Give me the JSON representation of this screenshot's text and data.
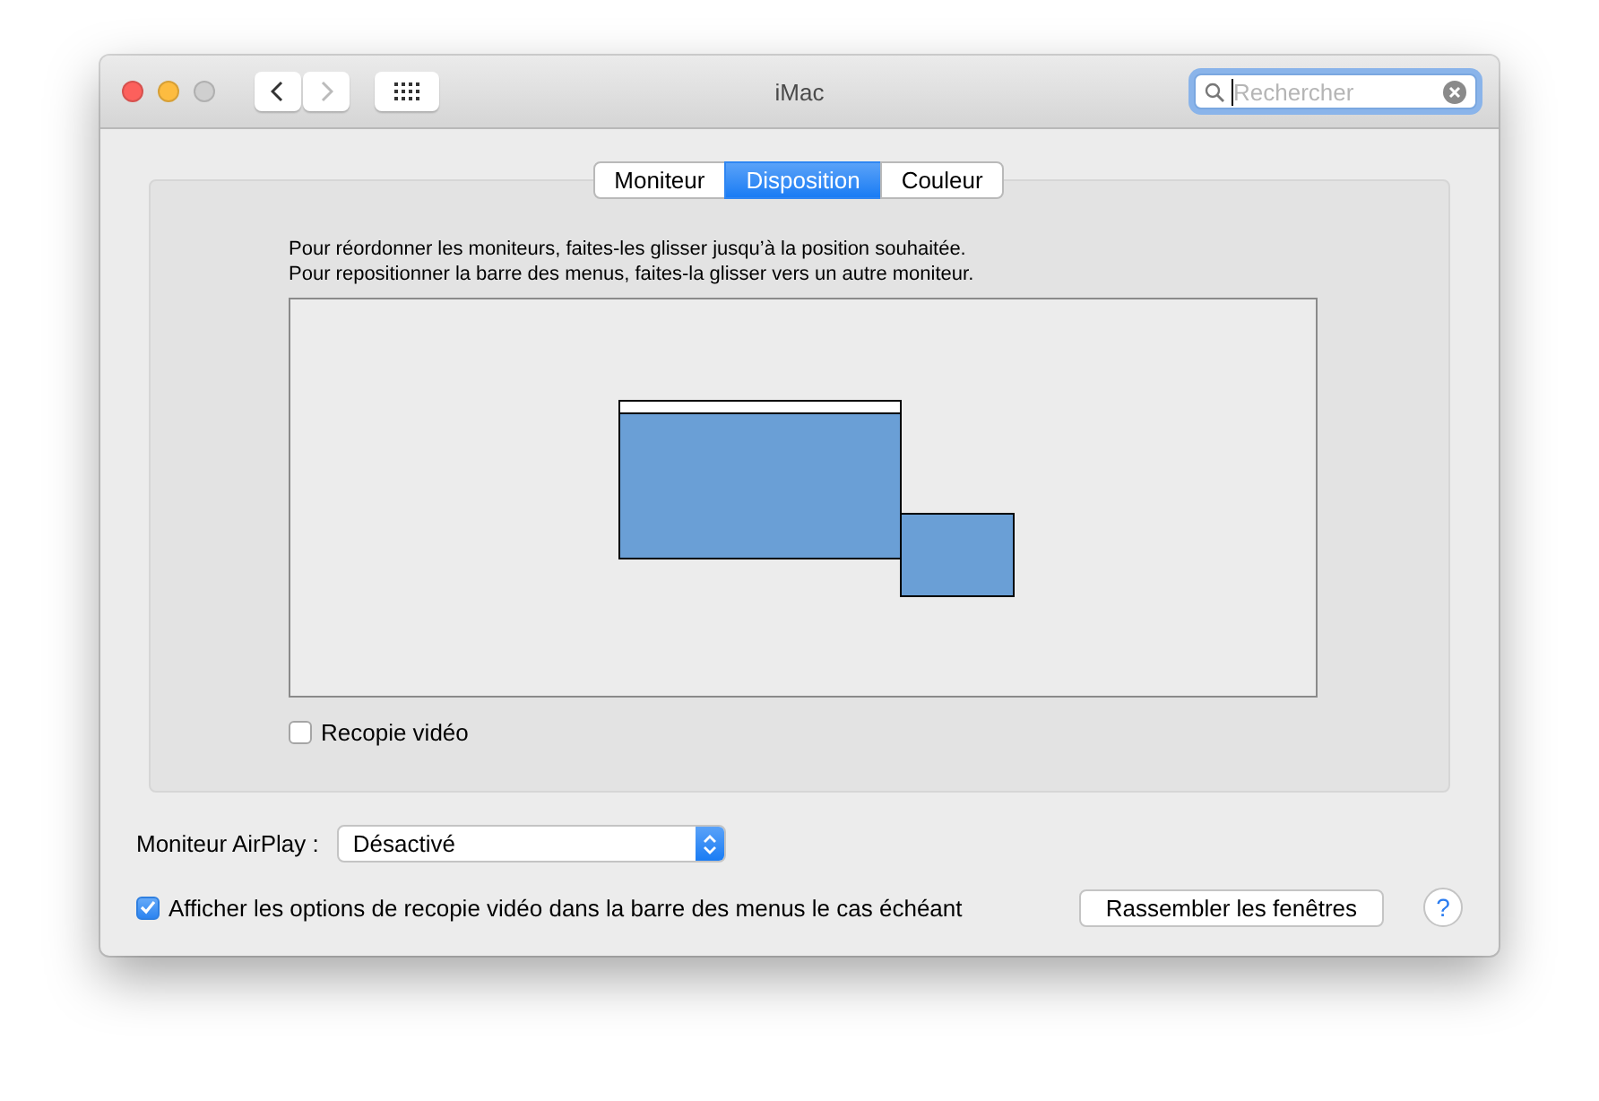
{
  "window": {
    "title": "iMac"
  },
  "search": {
    "placeholder": "Rechercher"
  },
  "tabs": [
    {
      "label": "Moniteur",
      "selected": false
    },
    {
      "label": "Disposition",
      "selected": true
    },
    {
      "label": "Couleur",
      "selected": false
    }
  ],
  "instructions": [
    "Pour réordonner les moniteurs, faites-les glisser jusqu’à la position souhaitée.",
    "Pour repositionner la barre des menus, faites-la glisser vers un autre moniteur."
  ],
  "displays": [
    {
      "menu_bar": true
    },
    {
      "menu_bar": false
    }
  ],
  "mirror_checkbox": {
    "label": "Recopie vidéo",
    "checked": false
  },
  "airplay": {
    "label": "Moniteur AirPlay :",
    "value": "Désactivé"
  },
  "menu_option": {
    "label": "Afficher les options de recopie vidéo dans la barre des menus le cas échéant",
    "checked": true
  },
  "gather_button": "Rassembler les fenêtres",
  "help_button": "?"
}
